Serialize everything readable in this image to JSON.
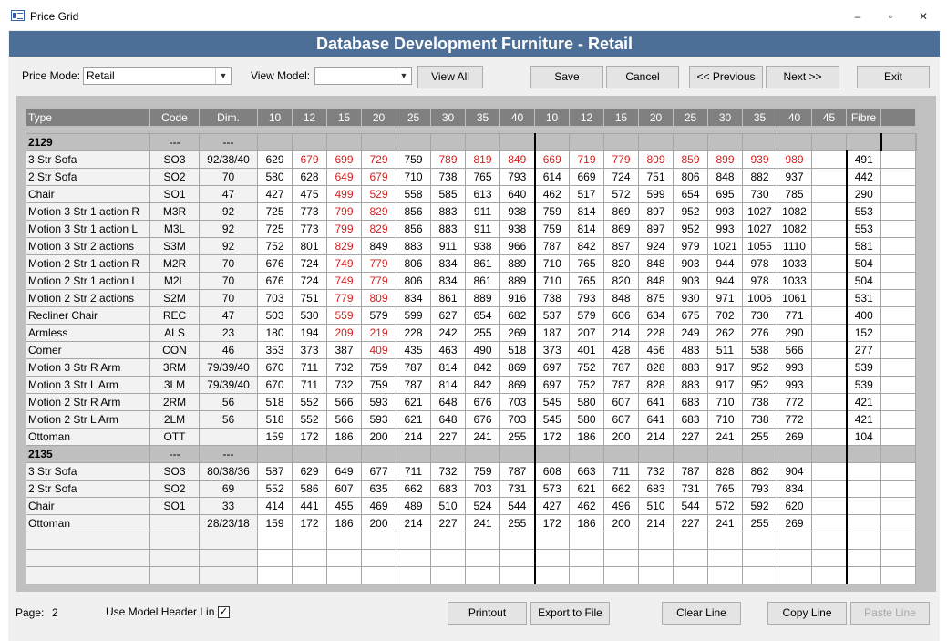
{
  "window": {
    "title": "Price Grid",
    "minimize": "–",
    "restore": "▫",
    "close": "✕"
  },
  "header": {
    "title": "Database Development Furniture - Retail"
  },
  "toolbar": {
    "price_mode_label": "Price Mode:",
    "price_mode_value": "Retail",
    "view_model_label": "View Model:",
    "view_model_value": "",
    "view_all": "View All",
    "save": "Save",
    "cancel": "Cancel",
    "previous": "<< Previous",
    "next": "Next >>",
    "exit": "Exit"
  },
  "grid": {
    "columns": [
      "Type",
      "Code",
      "Dim.",
      "10",
      "12",
      "15",
      "20",
      "25",
      "30",
      "35",
      "40",
      "10",
      "12",
      "15",
      "20",
      "25",
      "30",
      "35",
      "40",
      "45",
      "Fibre",
      ""
    ],
    "rows": [
      {
        "kind": "group",
        "type": "2129",
        "code": "---",
        "dim": "---",
        "v": [
          "",
          "",
          "",
          "",
          "",
          "",
          "",
          "",
          "",
          "",
          "",
          "",
          "",
          "",
          "",
          "",
          "",
          ""
        ],
        "fibre": "",
        "red": []
      },
      {
        "kind": "row",
        "type": "3 Str Sofa",
        "code": "SO3",
        "dim": "92/38/40",
        "v": [
          "629",
          "679",
          "699",
          "729",
          "759",
          "789",
          "819",
          "849",
          "669",
          "719",
          "779",
          "809",
          "859",
          "899",
          "939",
          "989",
          ""
        ],
        "fibre": "491",
        "red": [
          1,
          2,
          3,
          5,
          6,
          7,
          8,
          9,
          10,
          11,
          12,
          13,
          14,
          15
        ]
      },
      {
        "kind": "row",
        "type": "2 Str Sofa",
        "code": "SO2",
        "dim": "70",
        "v": [
          "580",
          "628",
          "649",
          "679",
          "710",
          "738",
          "765",
          "793",
          "614",
          "669",
          "724",
          "751",
          "806",
          "848",
          "882",
          "937",
          ""
        ],
        "fibre": "442",
        "red": [
          2,
          3
        ]
      },
      {
        "kind": "row",
        "type": "Chair",
        "code": "SO1",
        "dim": "47",
        "v": [
          "427",
          "475",
          "499",
          "529",
          "558",
          "585",
          "613",
          "640",
          "462",
          "517",
          "572",
          "599",
          "654",
          "695",
          "730",
          "785",
          ""
        ],
        "fibre": "290",
        "red": [
          2,
          3
        ]
      },
      {
        "kind": "row",
        "type": "Motion 3 Str 1 action R",
        "code": "M3R",
        "dim": "92",
        "v": [
          "725",
          "773",
          "799",
          "829",
          "856",
          "883",
          "911",
          "938",
          "759",
          "814",
          "869",
          "897",
          "952",
          "993",
          "1027",
          "1082",
          ""
        ],
        "fibre": "553",
        "red": [
          2,
          3
        ]
      },
      {
        "kind": "row",
        "type": "Motion 3 Str 1 action L",
        "code": "M3L",
        "dim": "92",
        "v": [
          "725",
          "773",
          "799",
          "829",
          "856",
          "883",
          "911",
          "938",
          "759",
          "814",
          "869",
          "897",
          "952",
          "993",
          "1027",
          "1082",
          ""
        ],
        "fibre": "553",
        "red": [
          2,
          3
        ]
      },
      {
        "kind": "row",
        "type": "Motion 3 Str 2 actions",
        "code": "S3M",
        "dim": "92",
        "v": [
          "752",
          "801",
          "829",
          "849",
          "883",
          "911",
          "938",
          "966",
          "787",
          "842",
          "897",
          "924",
          "979",
          "1021",
          "1055",
          "1110",
          ""
        ],
        "fibre": "581",
        "red": [
          2
        ]
      },
      {
        "kind": "row",
        "type": "Motion 2 Str 1 action R",
        "code": "M2R",
        "dim": "70",
        "v": [
          "676",
          "724",
          "749",
          "779",
          "806",
          "834",
          "861",
          "889",
          "710",
          "765",
          "820",
          "848",
          "903",
          "944",
          "978",
          "1033",
          ""
        ],
        "fibre": "504",
        "red": [
          2,
          3
        ]
      },
      {
        "kind": "row",
        "type": "Motion 2 Str 1 action L",
        "code": "M2L",
        "dim": "70",
        "v": [
          "676",
          "724",
          "749",
          "779",
          "806",
          "834",
          "861",
          "889",
          "710",
          "765",
          "820",
          "848",
          "903",
          "944",
          "978",
          "1033",
          ""
        ],
        "fibre": "504",
        "red": [
          2,
          3
        ]
      },
      {
        "kind": "row",
        "type": "Motion 2 Str 2 actions",
        "code": "S2M",
        "dim": "70",
        "v": [
          "703",
          "751",
          "779",
          "809",
          "834",
          "861",
          "889",
          "916",
          "738",
          "793",
          "848",
          "875",
          "930",
          "971",
          "1006",
          "1061",
          ""
        ],
        "fibre": "531",
        "red": [
          2,
          3
        ]
      },
      {
        "kind": "row",
        "type": "Recliner Chair",
        "code": "REC",
        "dim": "47",
        "v": [
          "503",
          "530",
          "559",
          "579",
          "599",
          "627",
          "654",
          "682",
          "537",
          "579",
          "606",
          "634",
          "675",
          "702",
          "730",
          "771",
          ""
        ],
        "fibre": "400",
        "red": [
          2
        ]
      },
      {
        "kind": "row",
        "type": "Armless",
        "code": "ALS",
        "dim": "23",
        "v": [
          "180",
          "194",
          "209",
          "219",
          "228",
          "242",
          "255",
          "269",
          "187",
          "207",
          "214",
          "228",
          "249",
          "262",
          "276",
          "290",
          ""
        ],
        "fibre": "152",
        "red": [
          2,
          3
        ]
      },
      {
        "kind": "row",
        "type": "Corner",
        "code": "CON",
        "dim": "46",
        "v": [
          "353",
          "373",
          "387",
          "409",
          "435",
          "463",
          "490",
          "518",
          "373",
          "401",
          "428",
          "456",
          "483",
          "511",
          "538",
          "566",
          ""
        ],
        "fibre": "277",
        "red": [
          3
        ]
      },
      {
        "kind": "row",
        "type": "Motion 3 Str R Arm",
        "code": "3RM",
        "dim": "79/39/40",
        "v": [
          "670",
          "711",
          "732",
          "759",
          "787",
          "814",
          "842",
          "869",
          "697",
          "752",
          "787",
          "828",
          "883",
          "917",
          "952",
          "993",
          ""
        ],
        "fibre": "539",
        "red": []
      },
      {
        "kind": "row",
        "type": "Motion 3 Str L Arm",
        "code": "3LM",
        "dim": "79/39/40",
        "v": [
          "670",
          "711",
          "732",
          "759",
          "787",
          "814",
          "842",
          "869",
          "697",
          "752",
          "787",
          "828",
          "883",
          "917",
          "952",
          "993",
          ""
        ],
        "fibre": "539",
        "red": []
      },
      {
        "kind": "row",
        "type": "Motion 2 Str R Arm",
        "code": "2RM",
        "dim": "56",
        "v": [
          "518",
          "552",
          "566",
          "593",
          "621",
          "648",
          "676",
          "703",
          "545",
          "580",
          "607",
          "641",
          "683",
          "710",
          "738",
          "772",
          ""
        ],
        "fibre": "421",
        "red": []
      },
      {
        "kind": "row",
        "type": "Motion 2 Str L Arm",
        "code": "2LM",
        "dim": "56",
        "v": [
          "518",
          "552",
          "566",
          "593",
          "621",
          "648",
          "676",
          "703",
          "545",
          "580",
          "607",
          "641",
          "683",
          "710",
          "738",
          "772",
          ""
        ],
        "fibre": "421",
        "red": []
      },
      {
        "kind": "row",
        "type": "Ottoman",
        "code": "OTT",
        "dim": "",
        "v": [
          "159",
          "172",
          "186",
          "200",
          "214",
          "227",
          "241",
          "255",
          "172",
          "186",
          "200",
          "214",
          "227",
          "241",
          "255",
          "269",
          ""
        ],
        "fibre": "104",
        "red": []
      },
      {
        "kind": "group",
        "type": "2135",
        "code": "---",
        "dim": "---",
        "v": [
          "",
          "",
          "",
          "",
          "",
          "",
          "",
          "",
          "",
          "",
          "",
          "",
          "",
          "",
          "",
          "",
          ""
        ],
        "fibre": "",
        "red": []
      },
      {
        "kind": "row",
        "type": "3 Str Sofa",
        "code": "SO3",
        "dim": "80/38/36",
        "v": [
          "587",
          "629",
          "649",
          "677",
          "711",
          "732",
          "759",
          "787",
          "608",
          "663",
          "711",
          "732",
          "787",
          "828",
          "862",
          "904",
          ""
        ],
        "fibre": "",
        "red": []
      },
      {
        "kind": "row",
        "type": "2 Str Sofa",
        "code": "SO2",
        "dim": "69",
        "v": [
          "552",
          "586",
          "607",
          "635",
          "662",
          "683",
          "703",
          "731",
          "573",
          "621",
          "662",
          "683",
          "731",
          "765",
          "793",
          "834",
          ""
        ],
        "fibre": "",
        "red": []
      },
      {
        "kind": "row",
        "type": "Chair",
        "code": "SO1",
        "dim": "33",
        "v": [
          "414",
          "441",
          "455",
          "469",
          "489",
          "510",
          "524",
          "544",
          "427",
          "462",
          "496",
          "510",
          "544",
          "572",
          "592",
          "620",
          ""
        ],
        "fibre": "",
        "red": []
      },
      {
        "kind": "row",
        "type": "Ottoman",
        "code": "",
        "dim": "28/23/18",
        "v": [
          "159",
          "172",
          "186",
          "200",
          "214",
          "227",
          "241",
          "255",
          "172",
          "186",
          "200",
          "214",
          "227",
          "241",
          "255",
          "269",
          ""
        ],
        "fibre": "",
        "red": []
      },
      {
        "kind": "row",
        "type": "",
        "code": "",
        "dim": "",
        "v": [
          "",
          "",
          "",
          "",
          "",
          "",
          "",
          "",
          "",
          "",
          "",
          "",
          "",
          "",
          "",
          "",
          ""
        ],
        "fibre": "",
        "red": []
      },
      {
        "kind": "row",
        "type": "",
        "code": "",
        "dim": "",
        "v": [
          "",
          "",
          "",
          "",
          "",
          "",
          "",
          "",
          "",
          "",
          "",
          "",
          "",
          "",
          "",
          "",
          ""
        ],
        "fibre": "",
        "red": []
      },
      {
        "kind": "row",
        "type": "",
        "code": "",
        "dim": "",
        "v": [
          "",
          "",
          "",
          "",
          "",
          "",
          "",
          "",
          "",
          "",
          "",
          "",
          "",
          "",
          "",
          "",
          ""
        ],
        "fibre": "",
        "red": []
      }
    ]
  },
  "footer": {
    "page_label": "Page:",
    "page_value": "2",
    "use_header_label": "Use Model Header Lin",
    "use_header_checked": "✓",
    "printout": "Printout",
    "export": "Export to File",
    "clear_line": "Clear Line",
    "copy_line": "Copy Line",
    "paste_line": "Paste Line"
  }
}
